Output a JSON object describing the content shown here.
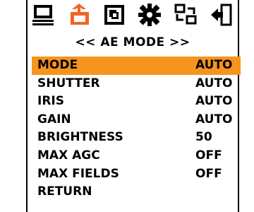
{
  "toolbar": {
    "icons": [
      {
        "name": "monitor-icon"
      },
      {
        "name": "camera-settings-icon"
      },
      {
        "name": "picture-icon"
      },
      {
        "name": "gear-icon"
      },
      {
        "name": "network-icon"
      },
      {
        "name": "exit-icon"
      }
    ]
  },
  "menu": {
    "title": "<< AE MODE >>",
    "selected_index": 0,
    "accent_color": "#f7941d",
    "items": [
      {
        "label": "MODE",
        "value": "AUTO"
      },
      {
        "label": "SHUTTER",
        "value": "AUTO"
      },
      {
        "label": "IRIS",
        "value": "AUTO"
      },
      {
        "label": "GAIN",
        "value": "AUTO"
      },
      {
        "label": "BRIGHTNESS",
        "value": "50"
      },
      {
        "label": "MAX AGC",
        "value": "OFF"
      },
      {
        "label": "MAX FIELDS",
        "value": "OFF"
      },
      {
        "label": "RETURN",
        "value": ""
      }
    ]
  }
}
